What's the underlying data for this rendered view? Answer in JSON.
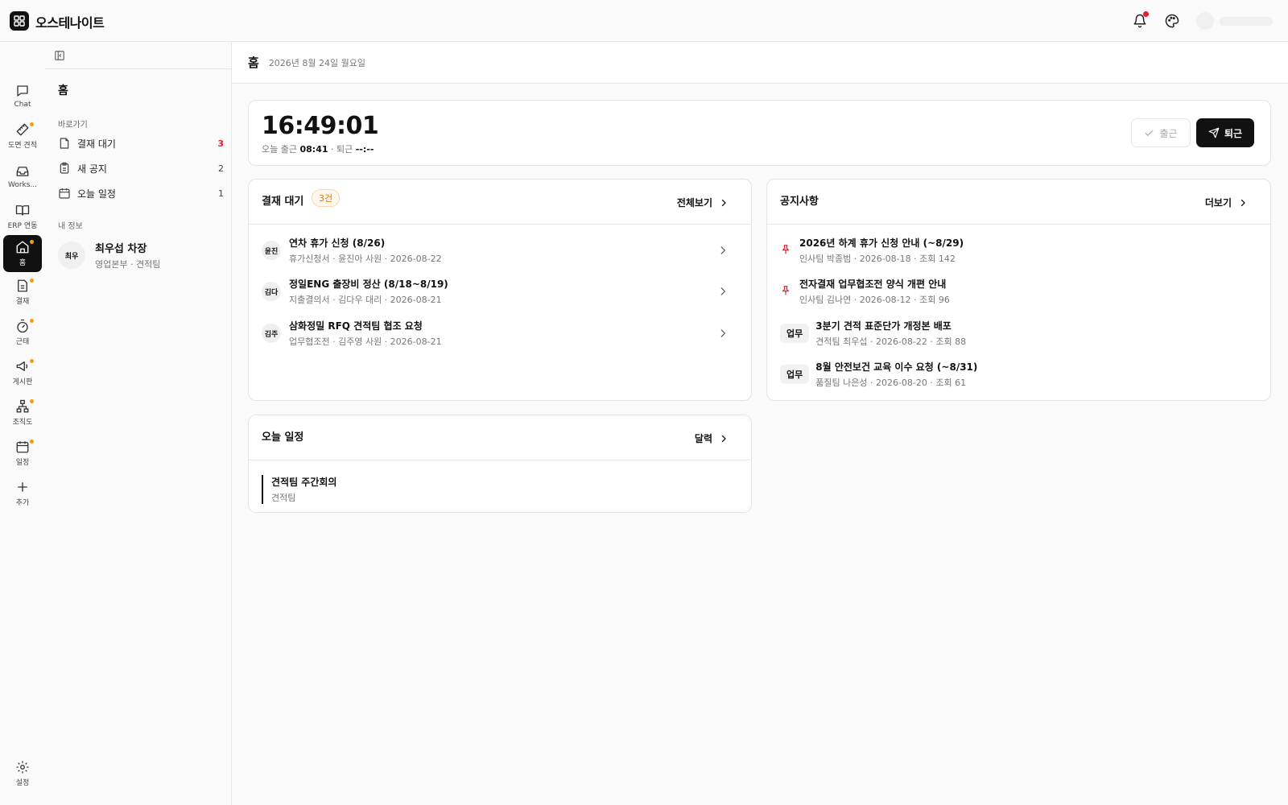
{
  "app": {
    "title": "오스테나이트"
  },
  "rail": {
    "items": [
      {
        "label": "Chat",
        "icon": "chat-icon",
        "dot": false,
        "active": false
      },
      {
        "label": "도면 견적",
        "icon": "ruler-icon",
        "dot": true,
        "active": false
      },
      {
        "label": "Works...",
        "icon": "inbox-icon",
        "dot": false,
        "active": false
      },
      {
        "label": "ERP 연동",
        "icon": "book-icon",
        "dot": false,
        "active": false
      },
      {
        "label": "홈",
        "icon": "home-icon",
        "dot": true,
        "active": true
      },
      {
        "label": "결재",
        "icon": "document-icon",
        "dot": true,
        "active": false
      },
      {
        "label": "근태",
        "icon": "timer-icon",
        "dot": true,
        "active": false
      },
      {
        "label": "게시판",
        "icon": "megaphone-icon",
        "dot": true,
        "active": false
      },
      {
        "label": "조직도",
        "icon": "org-chart-icon",
        "dot": true,
        "active": false
      },
      {
        "label": "일정",
        "icon": "calendar-icon",
        "dot": true,
        "active": false
      },
      {
        "label": "추가",
        "icon": "plus-icon",
        "dot": false,
        "active": false
      }
    ],
    "settings_label": "설정"
  },
  "panel": {
    "title": "홈",
    "shortcuts_label": "바로가기",
    "shortcuts": [
      {
        "label": "결재 대기",
        "count": "3",
        "icon": "file-icon"
      },
      {
        "label": "새 공지",
        "count": "2",
        "icon": "clipboard-icon"
      },
      {
        "label": "오늘 일정",
        "count": "1",
        "icon": "calendar-icon"
      }
    ],
    "my_info_label": "내 정보",
    "profile": {
      "avatar": "최우",
      "name": "최우섭 차장",
      "sub": "영업본부 · 견적팀"
    }
  },
  "main": {
    "title": "홈",
    "date": "2026년 8월 24일 월요일"
  },
  "clock": {
    "time": "16:49:01",
    "in_label": "오늘 출근",
    "in_time": "08:41",
    "out_label": "· 퇴근",
    "out_time": "--:--",
    "btn_in": "출근",
    "btn_out": "퇴근"
  },
  "approvals": {
    "title": "결재 대기",
    "badge": "3건",
    "link": "전체보기",
    "items": [
      {
        "avatar": "윤진",
        "title": "연차 휴가 신청 (8/26)",
        "sub": "휴가신청서 · 윤진아 사원 · 2026-08-22"
      },
      {
        "avatar": "김다",
        "title": "정일ENG 출장비 정산 (8/18~8/19)",
        "sub": "지출결의서 · 김다우 대리 · 2026-08-21"
      },
      {
        "avatar": "김주",
        "title": "삼화정밀 RFQ 견적팀 협조 요청",
        "sub": "업무협조전 · 김주영 사원 · 2026-08-21"
      }
    ]
  },
  "notices": {
    "title": "공지사항",
    "link": "더보기",
    "items": [
      {
        "pinned": true,
        "tag": "",
        "title": "2026년 하계 휴가 신청 안내 (~8/29)",
        "sub": "인사팀 박종범 · 2026-08-18 · 조회 142"
      },
      {
        "pinned": true,
        "tag": "",
        "title": "전자결재 업무협조전 양식 개편 안내",
        "sub": "인사팀 김나연 · 2026-08-12 · 조회 96"
      },
      {
        "pinned": false,
        "tag": "업무",
        "title": "3분기 견적 표준단가 개정본 배포",
        "sub": "견적팀 최우섭 · 2026-08-22 · 조회 88"
      },
      {
        "pinned": false,
        "tag": "업무",
        "title": "8월 안전보건 교육 이수 요청 (~8/31)",
        "sub": "품질팀 나은성 · 2026-08-20 · 조회 61"
      }
    ]
  },
  "schedule": {
    "title": "오늘 일정",
    "link": "달력",
    "items": [
      {
        "title": "견적팀 주간회의",
        "sub": "견적팀"
      }
    ]
  },
  "colors": {
    "accent": "#111111",
    "alert": "#e11d2e",
    "dot": "#f59e0b",
    "badge_text": "#d97706"
  }
}
